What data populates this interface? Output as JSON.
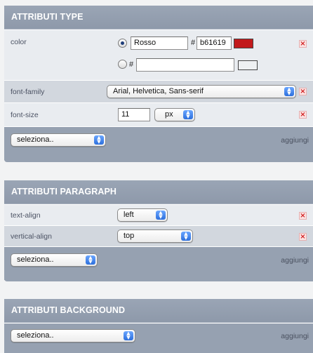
{
  "panels": {
    "type": {
      "title": "ATTRIBUTI TYPE",
      "color_label": "color",
      "color_name_value": "Rosso",
      "hash_symbol": "#",
      "color_hex_value": "b61619",
      "swatch_color": "#c21a1c",
      "font_family_label": "font-family",
      "font_family_value": "Arial, Helvetica, Sans-serif",
      "font_size_label": "font-size",
      "font_size_value": "11",
      "font_size_unit": "px",
      "select_label": "seleziona..",
      "add_label": "aggiungi"
    },
    "paragraph": {
      "title": "ATTRIBUTI PARAGRAPH",
      "text_align_label": "text-align",
      "text_align_value": "left",
      "vertical_align_label": "vertical-align",
      "vertical_align_value": "top",
      "select_label": "seleziona..",
      "add_label": "aggiungi"
    },
    "background": {
      "title": "ATTRIBUTI BACKGROUND",
      "select_label": "seleziona..",
      "add_label": "aggiungi"
    }
  },
  "remove_symbol": "×"
}
